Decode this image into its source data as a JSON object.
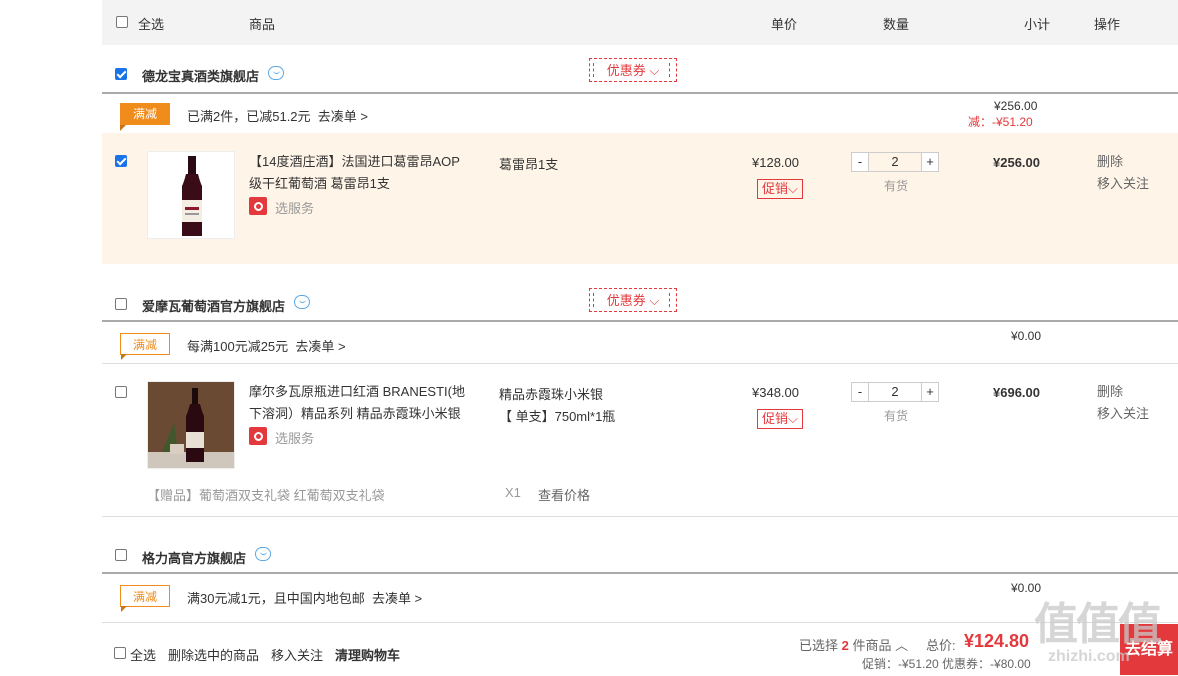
{
  "header": {
    "select_all": "全选",
    "col_product": "商品",
    "col_unit_price": "单价",
    "col_quantity": "数量",
    "col_subtotal": "小计",
    "col_actions": "操作"
  },
  "shops": [
    {
      "name": "德龙宝真酒类旗舰店",
      "checked": true,
      "coupon_label": "优惠券",
      "promo_tag": "满减",
      "promo_text": "已满2件，已减51.2元",
      "promo_link": "去凑单 >",
      "promo_amount": "¥256.00",
      "promo_discount": "减：-¥51.20",
      "items": [
        {
          "checked": true,
          "title_line1": "【14度酒庄酒】法国进口葛雷昂AOP",
          "title_line2": "级干红葡萄酒 葛雷昂1支",
          "service": "选服务",
          "spec_line1": "葛雷昂1支",
          "spec_line2": "",
          "unit_price": "¥128.00",
          "promo_btn": "促销",
          "quantity": "2",
          "stock": "有货",
          "subtotal": "¥256.00",
          "delete": "删除",
          "follow": "移入关注"
        }
      ]
    },
    {
      "name": "爱摩瓦葡萄酒官方旗舰店",
      "checked": false,
      "coupon_label": "优惠券",
      "promo_tag": "满减",
      "promo_text": "每满100元减25元",
      "promo_link": "去凑单 >",
      "promo_amount": "¥0.00",
      "items": [
        {
          "checked": false,
          "title_line1": "摩尔多瓦原瓶进口红酒 BRANESTI(地",
          "title_line2": "下溶洞）精品系列 精品赤霞珠小米银",
          "service": "选服务",
          "spec_line1": "精品赤霞珠小米银",
          "spec_line2": "【 单支】750ml*1瓶",
          "unit_price": "¥348.00",
          "promo_btn": "促销",
          "quantity": "2",
          "stock": "有货",
          "subtotal": "¥696.00",
          "delete": "删除",
          "follow": "移入关注",
          "gift": "【赠品】葡萄酒双支礼袋 红葡萄双支礼袋",
          "gift_qty": "X1",
          "gift_link": "查看价格"
        }
      ]
    },
    {
      "name": "格力高官方旗舰店",
      "checked": false,
      "promo_tag": "满减",
      "promo_text": "满30元减1元，且中国内地包邮",
      "promo_link": "去凑单 >",
      "promo_amount": "¥0.00"
    }
  ],
  "footer": {
    "select_all": "全选",
    "delete_selected": "删除选中的商品",
    "move_follow": "移入关注",
    "clear_cart": "清理购物车",
    "selected_prefix": "已选择",
    "selected_count": "2",
    "selected_suffix": "件商品",
    "total_label": "总价:",
    "total_value": "¥124.80",
    "promo_detail": "促销：-¥51.20 优惠券：-¥80.00",
    "checkout": "去结算"
  },
  "watermark": {
    "text": "值值值",
    "url": "zhizhi.com"
  },
  "colors": {
    "accent_red": "#e4393c",
    "promo_orange": "#f08c1c",
    "checkbox_blue": "#1a73e8",
    "highlight_row": "#fff4e8"
  }
}
